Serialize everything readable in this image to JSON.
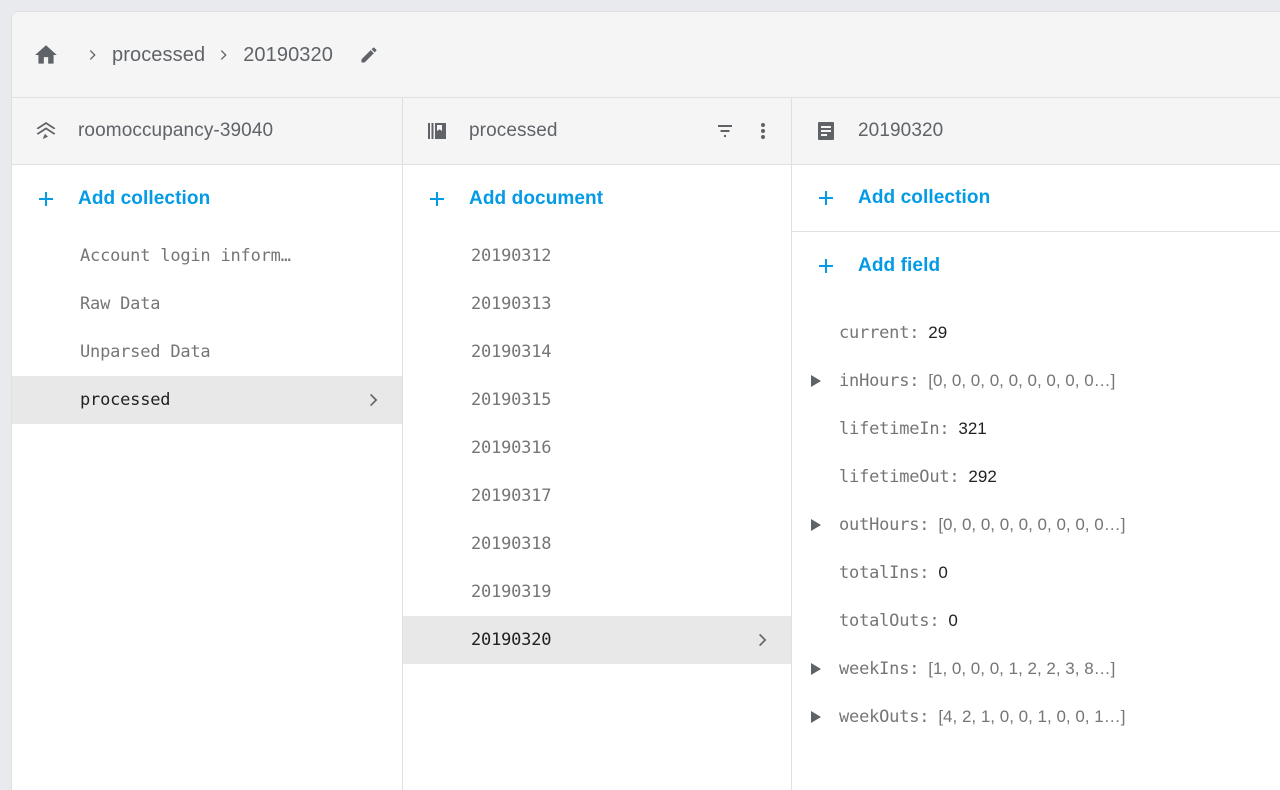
{
  "breadcrumb": {
    "home_icon": "home-icon",
    "separator_icon": "chevron-right-icon",
    "edit_icon": "pencil-edit-icon",
    "items": [
      {
        "label": "processed"
      },
      {
        "label": "20190320"
      }
    ]
  },
  "panels": {
    "project": {
      "icon": "firebase-stack-icon",
      "title": "roomoccupancy-39040",
      "add_button": {
        "icon": "plus-icon",
        "label": "Add collection"
      },
      "collections": [
        {
          "label": "Account login inform…",
          "selected": false
        },
        {
          "label": "Raw Data",
          "selected": false
        },
        {
          "label": "Unparsed Data",
          "selected": false
        },
        {
          "label": "processed",
          "selected": true
        }
      ]
    },
    "collection": {
      "icon": "collection-books-icon",
      "title": "processed",
      "filter_icon": "filter-list-icon",
      "menu_icon": "more-vert-icon",
      "add_button": {
        "icon": "plus-icon",
        "label": "Add document"
      },
      "documents": [
        {
          "label": "20190312",
          "selected": false
        },
        {
          "label": "20190313",
          "selected": false
        },
        {
          "label": "20190314",
          "selected": false
        },
        {
          "label": "20190315",
          "selected": false
        },
        {
          "label": "20190316",
          "selected": false
        },
        {
          "label": "20190317",
          "selected": false
        },
        {
          "label": "20190318",
          "selected": false
        },
        {
          "label": "20190319",
          "selected": false
        },
        {
          "label": "20190320",
          "selected": true
        }
      ]
    },
    "document": {
      "icon": "document-icon",
      "title": "20190320",
      "add_collection_button": {
        "icon": "plus-icon",
        "label": "Add collection"
      },
      "add_field_button": {
        "icon": "plus-icon",
        "label": "Add field"
      },
      "fields": [
        {
          "key": "current:",
          "value": "29",
          "expandable": false,
          "is_array": false
        },
        {
          "key": "inHours:",
          "value": "[0, 0, 0, 0, 0, 0, 0, 0, 0…]",
          "expandable": true,
          "is_array": true
        },
        {
          "key": "lifetimeIn:",
          "value": "321",
          "expandable": false,
          "is_array": false
        },
        {
          "key": "lifetimeOut:",
          "value": "292",
          "expandable": false,
          "is_array": false
        },
        {
          "key": "outHours:",
          "value": "[0, 0, 0, 0, 0, 0, 0, 0, 0…]",
          "expandable": true,
          "is_array": true
        },
        {
          "key": "totalIns:",
          "value": "0",
          "expandable": false,
          "is_array": false
        },
        {
          "key": "totalOuts:",
          "value": "0",
          "expandable": false,
          "is_array": false
        },
        {
          "key": "weekIns:",
          "value": "[1, 0, 0, 0, 1, 2, 2, 3, 8…]",
          "expandable": true,
          "is_array": true
        },
        {
          "key": "weekOuts:",
          "value": "[4, 2, 1, 0, 0, 1, 0, 0, 1…]",
          "expandable": true,
          "is_array": true
        }
      ]
    }
  },
  "colors": {
    "accent_blue": "#039be5",
    "page_background": "#e8eaed",
    "header_background": "#f5f5f5",
    "selected_row": "#e8e8e8",
    "muted_text": "#757575",
    "primary_text": "#202124"
  }
}
